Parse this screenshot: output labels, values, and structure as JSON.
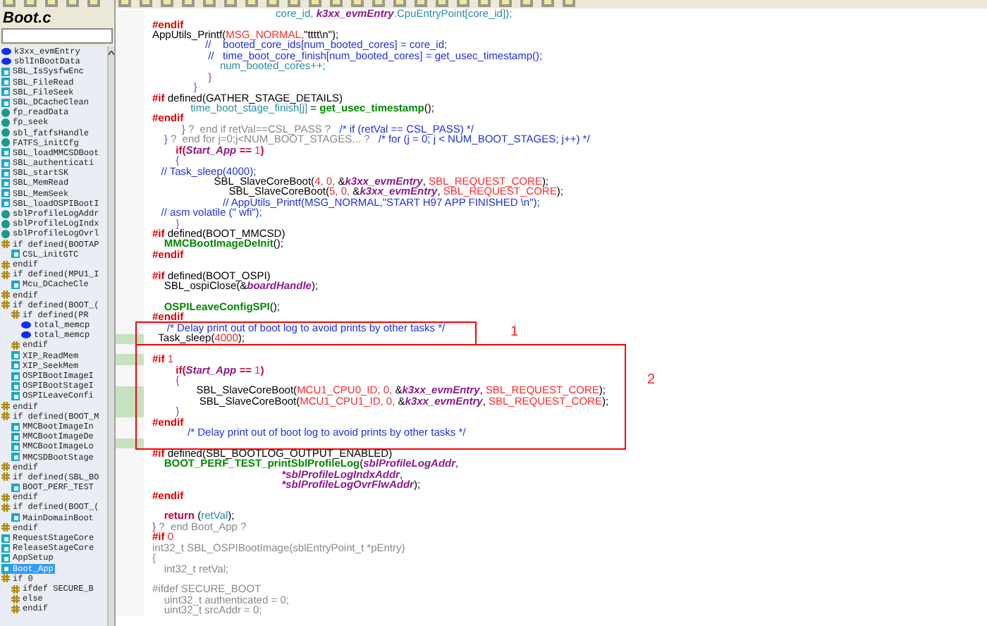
{
  "symbols_panel": {
    "title": "Boot.c",
    "items": [
      {
        "label": "k3xx_evmEntry",
        "kind": "variable",
        "selected": false
      },
      {
        "label": "sblInBootData",
        "kind": "variable",
        "selected": false
      },
      {
        "label": "SBL_IsSysfwEnc",
        "kind": "function",
        "selected": false
      },
      {
        "label": "SBL_FileRead",
        "kind": "function",
        "selected": false
      },
      {
        "label": "SBL_FileSeek",
        "kind": "function",
        "selected": false
      },
      {
        "label": "SBL_DCacheClean",
        "kind": "function",
        "selected": false
      },
      {
        "label": "fp_readData",
        "kind": "local",
        "selected": false
      },
      {
        "label": "fp_seek",
        "kind": "local",
        "selected": false
      },
      {
        "label": "sbl_fatfsHandle",
        "kind": "local",
        "selected": false
      },
      {
        "label": "FATFS_initCfg",
        "kind": "local",
        "selected": false
      },
      {
        "label": "SBL_loadMMCSDBoot",
        "kind": "function",
        "selected": false
      },
      {
        "label": "SBL_authenticati",
        "kind": "function",
        "selected": false
      },
      {
        "label": "SBL_startSK",
        "kind": "function",
        "selected": false
      },
      {
        "label": "SBL_MemRead",
        "kind": "function",
        "selected": false
      },
      {
        "label": "SBL_MemSeek",
        "kind": "function",
        "selected": false
      },
      {
        "label": "SBL_loadOSPIBootI",
        "kind": "function",
        "selected": false
      },
      {
        "label": "sblProfileLogAddr",
        "kind": "local",
        "selected": false
      },
      {
        "label": "sblProfileLogIndx",
        "kind": "local",
        "selected": false
      },
      {
        "label": "sblProfileLogOvrl",
        "kind": "local",
        "selected": false
      },
      {
        "label": "if defined(BOOTAP",
        "kind": "directive",
        "selected": false,
        "children": [
          {
            "label": "CSL_initGTC",
            "kind": "function",
            "selected": false
          }
        ]
      },
      {
        "label": "endif",
        "kind": "directive",
        "selected": false
      },
      {
        "label": "if defined(MPU1_I",
        "kind": "directive",
        "selected": false,
        "children": [
          {
            "label": "Mcu_DCacheCle",
            "kind": "function",
            "selected": false
          }
        ]
      },
      {
        "label": "endif",
        "kind": "directive",
        "selected": false
      },
      {
        "label": "if defined(BOOT_(",
        "kind": "directive",
        "selected": false,
        "children": [
          {
            "label": "if defined(PR",
            "kind": "directive",
            "selected": false,
            "children": [
              {
                "label": "total_memcp",
                "kind": "variable",
                "selected": false
              },
              {
                "label": "total_memcp",
                "kind": "variable",
                "selected": false
              }
            ]
          },
          {
            "label": "endif",
            "kind": "directive",
            "selected": false
          },
          {
            "label": "XIP_ReadMem",
            "kind": "function",
            "selected": false
          },
          {
            "label": "XIP_SeekMem",
            "kind": "function",
            "selected": false
          },
          {
            "label": "OSPIBootImageI",
            "kind": "function",
            "selected": false
          },
          {
            "label": "OSPIBootStageI",
            "kind": "function",
            "selected": false
          },
          {
            "label": "OSPILeaveConfi",
            "kind": "function",
            "selected": false
          }
        ]
      },
      {
        "label": "endif",
        "kind": "directive",
        "selected": false
      },
      {
        "label": "if defined(BOOT_M",
        "kind": "directive",
        "selected": false,
        "children": [
          {
            "label": "MMCBootImageIn",
            "kind": "function",
            "selected": false
          },
          {
            "label": "MMCBootImageDe",
            "kind": "function",
            "selected": false
          },
          {
            "label": "MMCBootImageLo",
            "kind": "function",
            "selected": false
          },
          {
            "label": "MMCSDBootStage",
            "kind": "function",
            "selected": false
          }
        ]
      },
      {
        "label": "endif",
        "kind": "directive",
        "selected": false
      },
      {
        "label": "if defined(SBL_BO",
        "kind": "directive",
        "selected": false,
        "children": [
          {
            "label": "BOOT_PERF_TEST",
            "kind": "function",
            "selected": false
          }
        ]
      },
      {
        "label": "endif",
        "kind": "directive",
        "selected": false
      },
      {
        "label": "if defined(BOOT_(",
        "kind": "directive",
        "selected": false,
        "children": [
          {
            "label": "MainDomainBoot",
            "kind": "function",
            "selected": false
          }
        ]
      },
      {
        "label": "endif",
        "kind": "directive",
        "selected": false
      },
      {
        "label": "RequestStageCore",
        "kind": "function",
        "selected": false
      },
      {
        "label": "ReleaseStageCore",
        "kind": "function",
        "selected": false
      },
      {
        "label": "AppSetup",
        "kind": "function",
        "selected": false
      },
      {
        "label": "Boot_App",
        "kind": "function",
        "selected": true
      },
      {
        "label": "if 0",
        "kind": "directive",
        "selected": false,
        "children": [
          {
            "label": "ifdef SECURE_B",
            "kind": "directive",
            "selected": false
          },
          {
            "label": "else",
            "kind": "directive",
            "selected": false
          },
          {
            "label": "endif",
            "kind": "directive",
            "selected": false
          }
        ]
      }
    ]
  },
  "editor": {
    "lines": [
      {
        "kind": "code",
        "changed": false,
        "segments": [
          {
            "text": "                                          core_id, ",
            "kind": "id"
          },
          {
            "text": "k3xx_evmEntry",
            "kind": "param"
          },
          {
            "text": ".CpuEntryPoint[core_id]);",
            "kind": "id"
          }
        ]
      },
      {
        "kind": "code",
        "changed": false,
        "segments": [
          {
            "text": "#endif",
            "kind": "directive"
          }
        ]
      },
      {
        "kind": "code",
        "changed": false,
        "segments": [
          {
            "text": "AppUtils_Printf(",
            "kind": "plain"
          },
          {
            "text": "MSG_NORMAL,",
            "kind": "macro"
          },
          {
            "text": "\"tttt\\n\"",
            "kind": "plain"
          },
          {
            "text": ");",
            "kind": "plain"
          }
        ]
      },
      {
        "kind": "code",
        "changed": false,
        "segments": [
          {
            "text": "                  //    booted_core_ids[num_booted_cores] = core_id;",
            "kind": "comment"
          }
        ]
      },
      {
        "kind": "code",
        "changed": false,
        "segments": [
          {
            "text": "                   //   time_boot_core_finish[num_booted_cores] = get_usec_timestamp();",
            "kind": "comment"
          }
        ]
      },
      {
        "kind": "code",
        "changed": false,
        "segments": [
          {
            "text": "                       num_booted_cores++;",
            "kind": "id"
          }
        ]
      },
      {
        "kind": "code",
        "changed": false,
        "segments": [
          {
            "text": "                   }",
            "kind": "brace"
          }
        ]
      },
      {
        "kind": "code",
        "changed": false,
        "segments": [
          {
            "text": "              }",
            "kind": "brace"
          }
        ]
      },
      {
        "kind": "code",
        "changed": false,
        "segments": [
          {
            "text": "#if",
            "kind": "directive"
          },
          {
            "text": " defined(GATHER_STAGE_DETAILS)",
            "kind": "plain"
          }
        ]
      },
      {
        "kind": "code",
        "changed": false,
        "segments": [
          {
            "text": "             time_boot_stage_finish[j]",
            "kind": "id"
          },
          {
            "text": " = ",
            "kind": "plain"
          },
          {
            "text": "get_usec_timestamp",
            "kind": "func"
          },
          {
            "text": "();",
            "kind": "plain"
          }
        ]
      },
      {
        "kind": "code",
        "changed": false,
        "segments": [
          {
            "text": "#endif",
            "kind": "directive"
          }
        ]
      },
      {
        "kind": "code",
        "changed": false,
        "segments": [
          {
            "text": "          }",
            "kind": "brace"
          },
          {
            "text": " ?  end if retVal==CSL_PASS ?",
            "kind": "grey"
          },
          {
            "text": "   /* if (retVal == CSL_PASS) */",
            "kind": "comment"
          }
        ]
      },
      {
        "kind": "code",
        "changed": false,
        "segments": [
          {
            "text": "    }",
            "kind": "brace"
          },
          {
            "text": " ?  end for j=0;j<NUM_BOOT_STAGES... ?",
            "kind": "grey"
          },
          {
            "text": "   /* for (j = 0; j < NUM_BOOT_STAGES; j++) */",
            "kind": "comment"
          }
        ]
      },
      {
        "kind": "code",
        "changed": false,
        "segments": [
          {
            "text": "        if(",
            "kind": "keyword"
          },
          {
            "text": "Start_App",
            "kind": "param"
          },
          {
            "text": " == ",
            "kind": "keyword"
          },
          {
            "text": "1",
            "kind": "number"
          },
          {
            "text": ")",
            "kind": "keyword"
          }
        ]
      },
      {
        "kind": "code",
        "changed": false,
        "segments": [
          {
            "text": "        {",
            "kind": "brace"
          }
        ]
      },
      {
        "kind": "code",
        "changed": false,
        "segments": [
          {
            "text": "   // Task_sleep(4000);",
            "kind": "comment"
          }
        ]
      },
      {
        "kind": "code",
        "changed": false,
        "segments": [
          {
            "text": "                     SBL_SlaveCoreBoot(",
            "kind": "plain"
          },
          {
            "text": "4, 0, ",
            "kind": "number"
          },
          {
            "text": "&",
            "kind": "plain"
          },
          {
            "text": "k3xx_evmEntry",
            "kind": "param"
          },
          {
            "text": ", ",
            "kind": "plain"
          },
          {
            "text": "SBL_REQUEST_CORE",
            "kind": "macro"
          },
          {
            "text": ");",
            "kind": "plain"
          }
        ]
      },
      {
        "kind": "code",
        "changed": false,
        "segments": [
          {
            "text": "                          SBL_SlaveCoreBoot(",
            "kind": "plain"
          },
          {
            "text": "5, 0, ",
            "kind": "number"
          },
          {
            "text": "&",
            "kind": "plain"
          },
          {
            "text": "k3xx_evmEntry",
            "kind": "param"
          },
          {
            "text": ", ",
            "kind": "plain"
          },
          {
            "text": "SBL_REQUEST_CORE",
            "kind": "macro"
          },
          {
            "text": ");",
            "kind": "plain"
          }
        ]
      },
      {
        "kind": "code",
        "changed": false,
        "segments": [
          {
            "text": "                        // AppUtils_Printf(MSG_NORMAL,\"START H97 APP FINISHED \\n\");",
            "kind": "comment"
          }
        ]
      },
      {
        "kind": "code",
        "changed": false,
        "segments": [
          {
            "text": "   // asm volatile (\" wfi\");",
            "kind": "comment"
          }
        ]
      },
      {
        "kind": "code",
        "changed": false,
        "segments": [
          {
            "text": "        }",
            "kind": "brace"
          }
        ]
      },
      {
        "kind": "code",
        "changed": false,
        "segments": [
          {
            "text": "#if",
            "kind": "directive"
          },
          {
            "text": " defined(BOOT_MMCSD)",
            "kind": "plain"
          }
        ]
      },
      {
        "kind": "code",
        "changed": false,
        "segments": [
          {
            "text": "    MMCBootImageDeInit",
            "kind": "func"
          },
          {
            "text": "();",
            "kind": "plain"
          }
        ]
      },
      {
        "kind": "code",
        "changed": false,
        "segments": [
          {
            "text": "#endif",
            "kind": "directive"
          }
        ]
      },
      {
        "kind": "blank",
        "changed": false
      },
      {
        "kind": "code",
        "changed": false,
        "segments": [
          {
            "text": "#if",
            "kind": "directive"
          },
          {
            "text": " defined(BOOT_OSPI)",
            "kind": "plain"
          }
        ]
      },
      {
        "kind": "code",
        "changed": false,
        "segments": [
          {
            "text": "    SBL_ospiClose(",
            "kind": "plain"
          },
          {
            "text": "&",
            "kind": "plain"
          },
          {
            "text": "boardHandle",
            "kind": "param"
          },
          {
            "text": ");",
            "kind": "plain"
          }
        ]
      },
      {
        "kind": "blank",
        "changed": false
      },
      {
        "kind": "code",
        "changed": false,
        "segments": [
          {
            "text": "    OSPILeaveConfigSPI",
            "kind": "func"
          },
          {
            "text": "();",
            "kind": "plain"
          }
        ]
      },
      {
        "kind": "code",
        "changed": false,
        "segments": [
          {
            "text": "#endif",
            "kind": "directive"
          }
        ]
      },
      {
        "kind": "code",
        "changed": false,
        "segments": [
          {
            "text": "     /* Delay print out of boot log to avoid prints by other tasks */",
            "kind": "comment"
          }
        ]
      },
      {
        "kind": "code",
        "changed": true,
        "segments": [
          {
            "text": "  Task_sleep(",
            "kind": "plain"
          },
          {
            "text": "4000",
            "kind": "number"
          },
          {
            "text": ");",
            "kind": "plain"
          }
        ]
      },
      {
        "kind": "blank",
        "changed": false
      },
      {
        "kind": "code",
        "changed": true,
        "segments": [
          {
            "text": "#if",
            "kind": "directive"
          },
          {
            "text": " 1",
            "kind": "number"
          }
        ]
      },
      {
        "kind": "code",
        "changed": false,
        "segments": [
          {
            "text": "        if(",
            "kind": "keyword"
          },
          {
            "text": "Start_App",
            "kind": "param"
          },
          {
            "text": " == ",
            "kind": "keyword"
          },
          {
            "text": "1",
            "kind": "number"
          },
          {
            "text": ")",
            "kind": "keyword"
          }
        ]
      },
      {
        "kind": "code",
        "changed": false,
        "segments": [
          {
            "text": "        {",
            "kind": "brace"
          }
        ]
      },
      {
        "kind": "code",
        "changed": true,
        "segments": [
          {
            "text": "               SBL_SlaveCoreBoot(",
            "kind": "plain"
          },
          {
            "text": "MCU1_CPU0_ID,",
            "kind": "macro"
          },
          {
            "text": " 0, ",
            "kind": "number"
          },
          {
            "text": "&",
            "kind": "plain"
          },
          {
            "text": "k3xx_evmEntry",
            "kind": "param"
          },
          {
            "text": ", ",
            "kind": "plain"
          },
          {
            "text": "SBL_REQUEST_CORE",
            "kind": "macro"
          },
          {
            "text": ");",
            "kind": "plain"
          }
        ]
      },
      {
        "kind": "code",
        "changed": true,
        "segments": [
          {
            "text": "                SBL_SlaveCoreBoot(",
            "kind": "plain"
          },
          {
            "text": "MCU1_CPU1_ID,",
            "kind": "macro"
          },
          {
            "text": " 0, ",
            "kind": "number"
          },
          {
            "text": "&",
            "kind": "plain"
          },
          {
            "text": "k3xx_evmEntry",
            "kind": "param"
          },
          {
            "text": ", ",
            "kind": "plain"
          },
          {
            "text": "SBL_REQUEST_CORE",
            "kind": "macro"
          },
          {
            "text": ");",
            "kind": "plain"
          }
        ]
      },
      {
        "kind": "code",
        "changed": true,
        "segments": [
          {
            "text": "        }",
            "kind": "brace"
          }
        ]
      },
      {
        "kind": "code",
        "changed": false,
        "segments": [
          {
            "text": "#endif",
            "kind": "directive"
          }
        ]
      },
      {
        "kind": "code",
        "changed": false,
        "segments": [
          {
            "text": "            /* Delay print out of boot log to avoid prints by other tasks */",
            "kind": "comment"
          }
        ]
      },
      {
        "kind": "blank",
        "changed": true
      },
      {
        "kind": "code",
        "changed": false,
        "segments": [
          {
            "text": "#if",
            "kind": "directive"
          },
          {
            "text": " defined(SBL_BOOTLOG_OUTPUT_ENABLED)",
            "kind": "plain"
          }
        ]
      },
      {
        "kind": "code",
        "changed": false,
        "segments": [
          {
            "text": "    BOOT_PERF_TEST_printSblProfileLog",
            "kind": "func"
          },
          {
            "text": "(",
            "kind": "plain"
          },
          {
            "text": "sblProfileLogAddr",
            "kind": "param"
          },
          {
            "text": ",",
            "kind": "plain"
          }
        ]
      },
      {
        "kind": "code",
        "changed": false,
        "segments": [
          {
            "text": "                                            *sblProfileLogIndxAddr",
            "kind": "param"
          },
          {
            "text": ",",
            "kind": "plain"
          }
        ]
      },
      {
        "kind": "code",
        "changed": false,
        "segments": [
          {
            "text": "                                            *sblProfileLogOvrFlwAddr",
            "kind": "param"
          },
          {
            "text": ");",
            "kind": "plain"
          }
        ]
      },
      {
        "kind": "code",
        "changed": false,
        "segments": [
          {
            "text": "#endif",
            "kind": "directive"
          }
        ]
      },
      {
        "kind": "blank",
        "changed": false
      },
      {
        "kind": "code",
        "changed": false,
        "segments": [
          {
            "text": "    return",
            "kind": "keyword"
          },
          {
            "text": " (",
            "kind": "plain"
          },
          {
            "text": "retVal",
            "kind": "id"
          },
          {
            "text": ");",
            "kind": "plain"
          }
        ]
      },
      {
        "kind": "code",
        "changed": false,
        "segments": [
          {
            "text": "}",
            "kind": "brace"
          },
          {
            "text": " ?  end Boot_App ?",
            "kind": "grey"
          }
        ]
      },
      {
        "kind": "code",
        "changed": false,
        "segments": [
          {
            "text": "#if",
            "kind": "directive"
          },
          {
            "text": " 0",
            "kind": "number"
          }
        ]
      },
      {
        "kind": "code",
        "changed": false,
        "segments": [
          {
            "text": "int32_t SBL_OSPIBootImage(sblEntryPoint_t *pEntry)",
            "kind": "grey"
          }
        ]
      },
      {
        "kind": "code",
        "changed": false,
        "segments": [
          {
            "text": "{",
            "kind": "grey"
          }
        ]
      },
      {
        "kind": "code",
        "changed": false,
        "segments": [
          {
            "text": "    int32_t retVal;",
            "kind": "grey"
          }
        ]
      },
      {
        "kind": "blank",
        "changed": false
      },
      {
        "kind": "code",
        "changed": false,
        "segments": [
          {
            "text": "#ifdef SECURE_BOOT",
            "kind": "grey"
          }
        ]
      },
      {
        "kind": "code",
        "changed": false,
        "segments": [
          {
            "text": "    uint32_t authenticated = 0;",
            "kind": "grey"
          }
        ]
      },
      {
        "kind": "code",
        "changed": false,
        "segments": [
          {
            "text": "    uint32_t srcAddr = 0;",
            "kind": "grey"
          }
        ]
      }
    ]
  },
  "annotations": [
    {
      "label": "1"
    },
    {
      "label": "2"
    }
  ]
}
